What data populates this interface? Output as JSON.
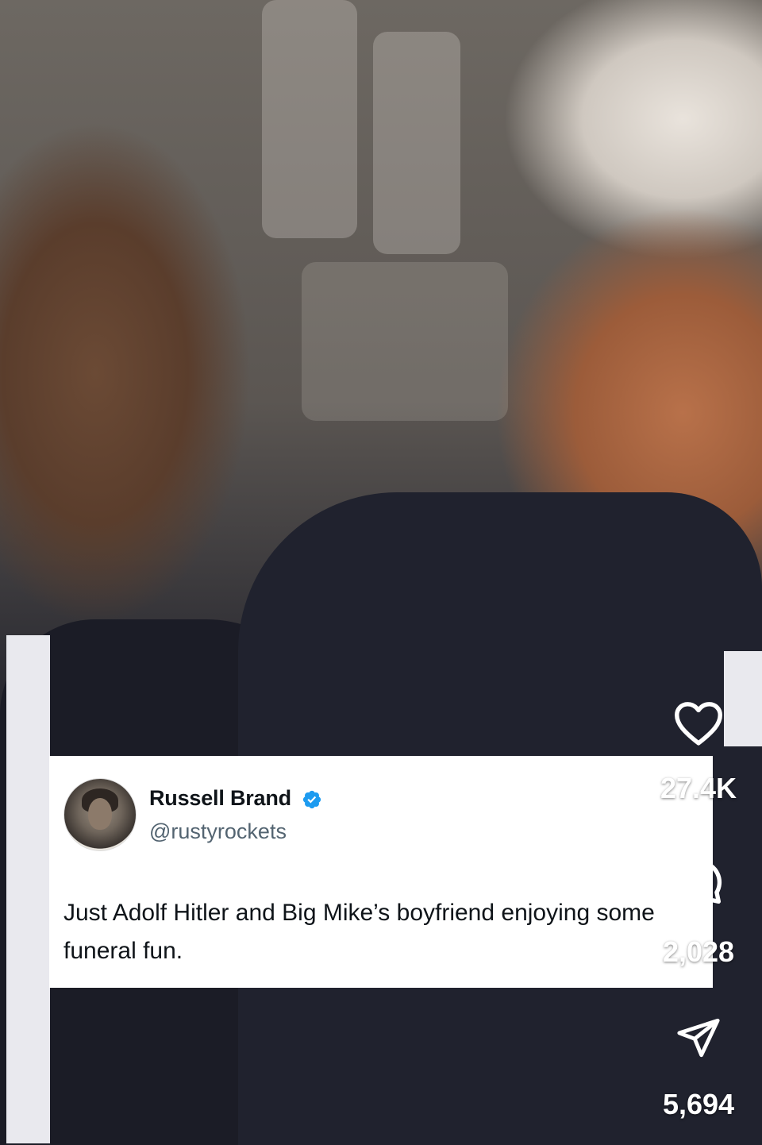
{
  "tweet": {
    "author_name": "Russell Brand",
    "author_handle": "@rustyrockets",
    "text": "Just Adolf Hitler and Big Mike’s boyfriend enjoying some funeral fun.",
    "verified": true,
    "verified_color": "#1d9bf0"
  },
  "actions": {
    "likes": {
      "icon": "heart-icon",
      "count": "27.4K"
    },
    "comments": {
      "icon": "comment-bubble-icon",
      "count": "2,028"
    },
    "shares": {
      "icon": "send-icon",
      "count": "5,694"
    }
  }
}
